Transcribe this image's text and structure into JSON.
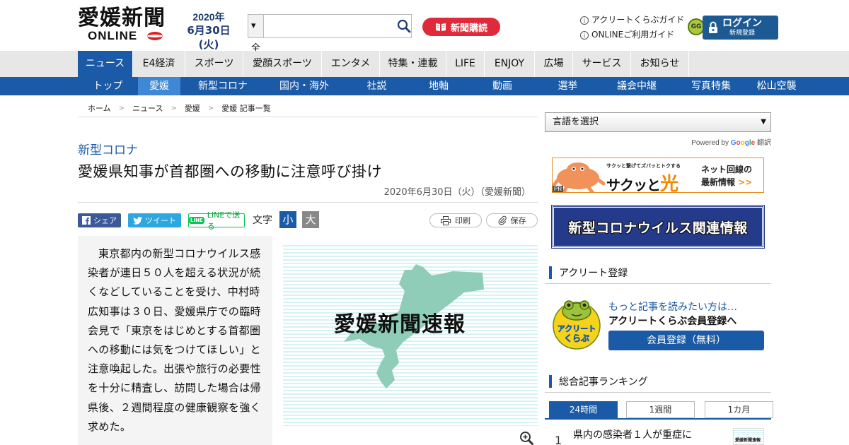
{
  "header": {
    "logo_jp": "愛媛新聞",
    "logo_en": "ONLINE",
    "date_year": "2020年",
    "date_day": "6月30日(火)",
    "search_scope": "▾ 全て",
    "search_placeholder": "",
    "subscribe_label": "新聞購読",
    "guide_links": [
      "アクリートくらぶガイド",
      "ONLINEご利用ガイド"
    ],
    "login_label": "ログイン",
    "register_label": "新規登録"
  },
  "nav": {
    "main": [
      {
        "label": "ニュース",
        "w": 78,
        "active": true
      },
      {
        "label": "E4経済",
        "w": 74
      },
      {
        "label": "スポーツ",
        "w": 82
      },
      {
        "label": "愛顔スポーツ",
        "w": 111
      },
      {
        "label": "エンタメ",
        "w": 82
      },
      {
        "label": "特集・連載",
        "w": 94
      },
      {
        "label": "LIFE",
        "w": 54
      },
      {
        "label": "ENJOY",
        "w": 71
      },
      {
        "label": "広場",
        "w": 54
      },
      {
        "label": "サービス",
        "w": 82
      },
      {
        "label": "お知らせ",
        "w": 82
      }
    ],
    "sub": [
      {
        "label": "トップ",
        "w": 85
      },
      {
        "label": "愛媛",
        "w": 60,
        "active": true
      },
      {
        "label": "新型コロナ",
        "w": 120
      },
      {
        "label": "国内・海外",
        "w": 110
      },
      {
        "label": "社説",
        "w": 95
      },
      {
        "label": "地軸",
        "w": 80
      },
      {
        "label": "動画",
        "w": 100
      },
      {
        "label": "選挙",
        "w": 85
      },
      {
        "label": "議会中継",
        "w": 110
      },
      {
        "label": "写真特集",
        "w": 100
      },
      {
        "label": "松山空襲",
        "w": 85
      }
    ]
  },
  "breadcrumb": [
    "ホーム",
    "ニュース",
    "愛媛",
    "愛媛 記事一覧"
  ],
  "breadcrumb_sep": ">",
  "article": {
    "category": "新型コロナ",
    "title": "愛媛県知事が首都圏への移動に注意呼び掛け",
    "byline": "2020年6月30日（火）（愛媛新聞）",
    "share_facebook": "シェア",
    "share_twitter": "ツイート",
    "share_line": "LINEで送る",
    "line_badge": "LINE",
    "font_size_label": "文字",
    "font_small": "小",
    "font_large": "大",
    "print_label": "印刷",
    "save_label": "保存",
    "body": "東京都内の新型コロナウイルス感染者が連日５０人を超える状況が続くなどしていることを受け、中村時広知事は３０日、愛媛県庁での臨時会見で「東京をはじめとする首都圏への移動には気をつけてほしい」と注意喚起した。出張や旅行の必要性を十分に精査し、訪問した場合は帰県後、２週間程度の健康観察を強く求めた。",
    "photo_caption": "愛媛新聞速報"
  },
  "sidebar": {
    "language_select": "言語を選択",
    "powered_by": "Powered by",
    "google": "Google",
    "translate": "翻訳",
    "ad": {
      "pr": "PR",
      "small": "サクッと繋げてズバッとトクする",
      "big_a": "サクッと",
      "big_b": "光",
      "right_1": "ネット回線の",
      "right_2": "最新情報",
      "right_arrows": ">>"
    },
    "corona_banner": "新型コロナウイルス関連情報",
    "acculito_heading": "アクリート登録",
    "club_line1": "もっと記事を読みたい方は…",
    "club_line2": "アクリートくらぶ会員登録へ",
    "member_button": "会員登録（無料）",
    "mascot_text": "アクリートくらぶ",
    "ranking_heading": "総合記事ランキング",
    "ranking_tabs": [
      "24時間",
      "1週間",
      "1カ月"
    ],
    "ranking": [
      {
        "rank": "1",
        "title": "県内の感染者１人が重症に",
        "thumb": "愛媛新聞速報"
      }
    ]
  },
  "colors": {
    "brand_blue": "#1a5aa6",
    "subscribe_red": "#e02a3a",
    "login_blue": "#1d5a94",
    "corona_banner": "#243a8a",
    "map_green": "#8fcdb8"
  }
}
